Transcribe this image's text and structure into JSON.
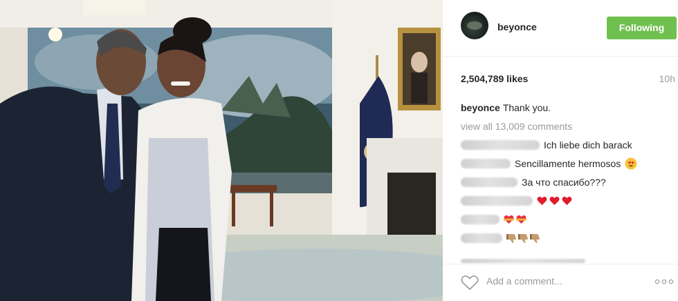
{
  "post": {
    "photo_alt": "photo",
    "header": {
      "username": "beyonce",
      "follow_label": "Following"
    },
    "likes_text": "2,504,789 likes",
    "time_ago": "10h",
    "caption": {
      "username": "beyonce",
      "text": "Thank you."
    },
    "view_all_comments": "view all 13,009 comments",
    "comments": [
      {
        "text": "Ich liebe dich barack",
        "emoji": ""
      },
      {
        "text": "Sencillamente hermosos",
        "emoji": "heart-eyes"
      },
      {
        "text": "За что спасибо???",
        "emoji": ""
      },
      {
        "text": "",
        "emoji": "red-heart x3"
      },
      {
        "text": "",
        "emoji": "heart-ribbon x2"
      },
      {
        "text": "",
        "emoji": "thumbs-down x3"
      }
    ],
    "add_comment_placeholder": "Add a comment...",
    "icons": {
      "like": "heart-outline-icon",
      "more": "ellipsis-icon"
    },
    "colors": {
      "follow_button": "#70c050",
      "muted_text": "#999999",
      "text": "#262626"
    }
  }
}
